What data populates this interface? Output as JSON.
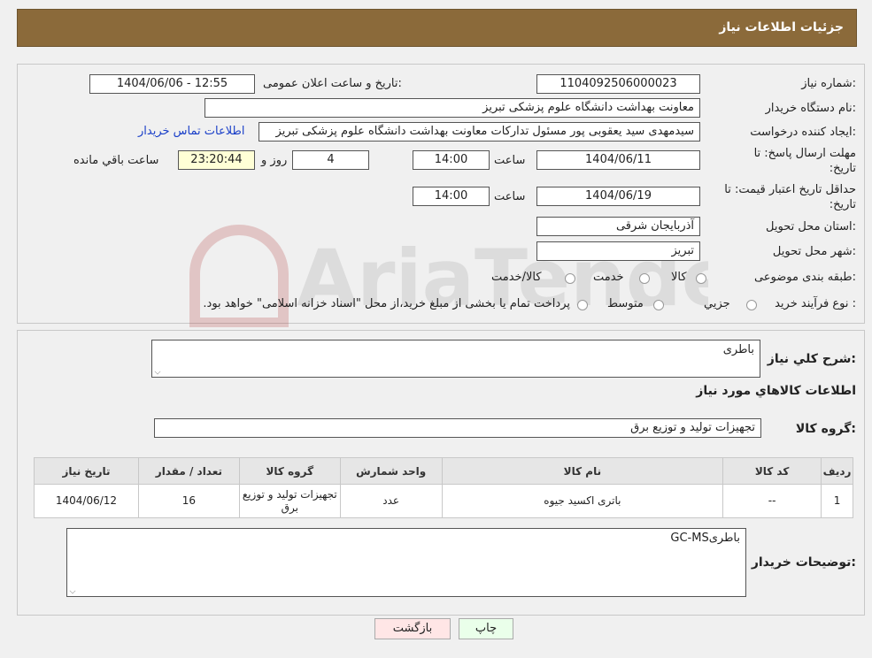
{
  "header": {
    "title": "جزئیات اطلاعات نیاز"
  },
  "form": {
    "need_number_label": "شماره نیاز:",
    "need_number": "1104092506000023",
    "announce_label": "تاریخ و ساعت اعلان عمومی:",
    "announce_value": "1404/06/06 - 12:55",
    "buyer_org_label": "نام دستگاه خریدار:",
    "buyer_org": "معاونت بهداشت دانشگاه علوم پزشکی تبریز",
    "creator_label": "ایجاد کننده درخواست:",
    "creator": "سیدمهدی سید یعقوبی پور مسئول تدارکات معاونت بهداشت دانشگاه علوم پزشکی تبریز",
    "contact_link": "اطلاعات تماس خریدار",
    "reply_deadline_label_1": "مهلت ارسال پاسخ: تا",
    "reply_deadline_label_2": "تاریخ:",
    "reply_date": "1404/06/11",
    "time_label": "ساعت",
    "reply_time": "14:00",
    "days_value": "4",
    "days_label": "روز و",
    "remaining_time": "23:20:44",
    "remaining_label": "ساعت باقي مانده",
    "validity_label_1": "حداقل تاریخ اعتبار قیمت: تا",
    "validity_label_2": "تاریخ:",
    "validity_date": "1404/06/19",
    "validity_time": "14:00",
    "province_label": "استان محل تحویل:",
    "province": "آذربایجان شرقی",
    "city_label": "شهر محل تحویل:",
    "city": "تبریز",
    "category_label": "طبقه بندی موضوعی:",
    "category_options": [
      "کالا",
      "خدمت",
      "کالا/خدمت"
    ],
    "process_label": "نوع فرآیند خرید :",
    "process_options": [
      "جزیي",
      "متوسط"
    ],
    "process_note": "پرداخت تمام یا بخشی از مبلغ خرید،از محل \"اسناد خزانه اسلامی\" خواهد بود."
  },
  "description": {
    "label": "شرح کلي نياز:",
    "value": "باطری"
  },
  "goods": {
    "section_title": "اطلاعات كالاهاي مورد نياز",
    "group_label": "گروه کالا:",
    "group_value": "تجهیزات تولید و توزیع برق",
    "columns": [
      "رديف",
      "كد كالا",
      "نام كالا",
      "واحد شمارش",
      "گروه كالا",
      "تعداد / مقدار",
      "تاريخ نياز"
    ],
    "rows": [
      [
        "1",
        "--",
        "باتری اکسید جیوه",
        "عدد",
        "تجهیزات تولید و توزیع برق",
        "16",
        "1404/06/12"
      ]
    ]
  },
  "buyer_notes": {
    "label": "توضیحات خریدار:",
    "value": "باطریGC-MS"
  },
  "buttons": {
    "print": "چاپ",
    "back": "بازگشت"
  },
  "watermark": {
    "text": "AriaTender.neT"
  }
}
